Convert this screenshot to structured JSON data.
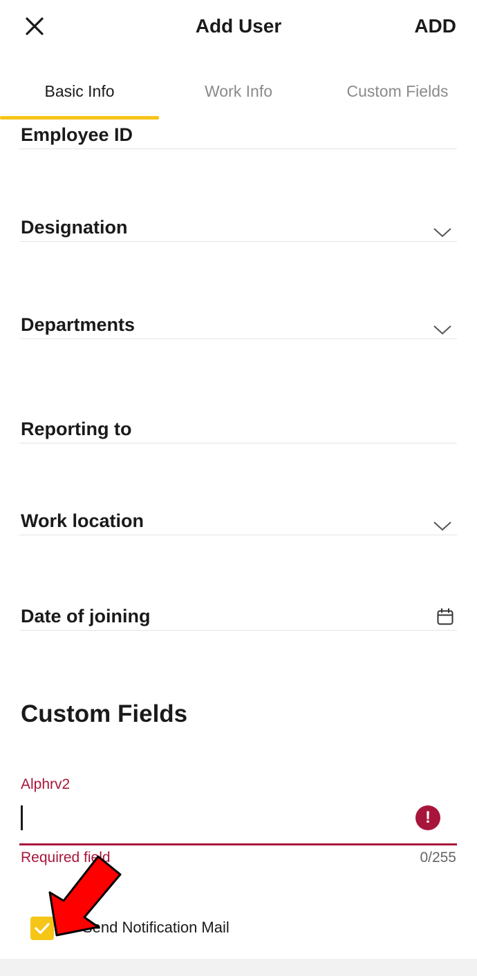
{
  "header": {
    "title": "Add User",
    "action_label": "ADD",
    "close_icon": "close-icon"
  },
  "tabs": [
    {
      "label": "Basic Info",
      "active": true
    },
    {
      "label": "Work Info",
      "active": false
    },
    {
      "label": "Custom Fields",
      "active": false
    }
  ],
  "form": {
    "employee_id_label": "Employee ID",
    "designation_label": "Designation",
    "departments_label": "Departments",
    "reporting_to_label": "Reporting to",
    "work_location_label": "Work location",
    "date_of_joining_label": "Date of joining"
  },
  "custom_fields": {
    "section_title": "Custom Fields",
    "field_label": "Alphrv2",
    "field_value": "",
    "helper_text": "Required field",
    "counter": "0/255",
    "error_icon": "error-icon"
  },
  "notification": {
    "label": "Send Notification Mail",
    "checked": true
  },
  "colors": {
    "accent": "#f5c518",
    "error": "#a8153a",
    "annotation_arrow": "#ff0000"
  }
}
